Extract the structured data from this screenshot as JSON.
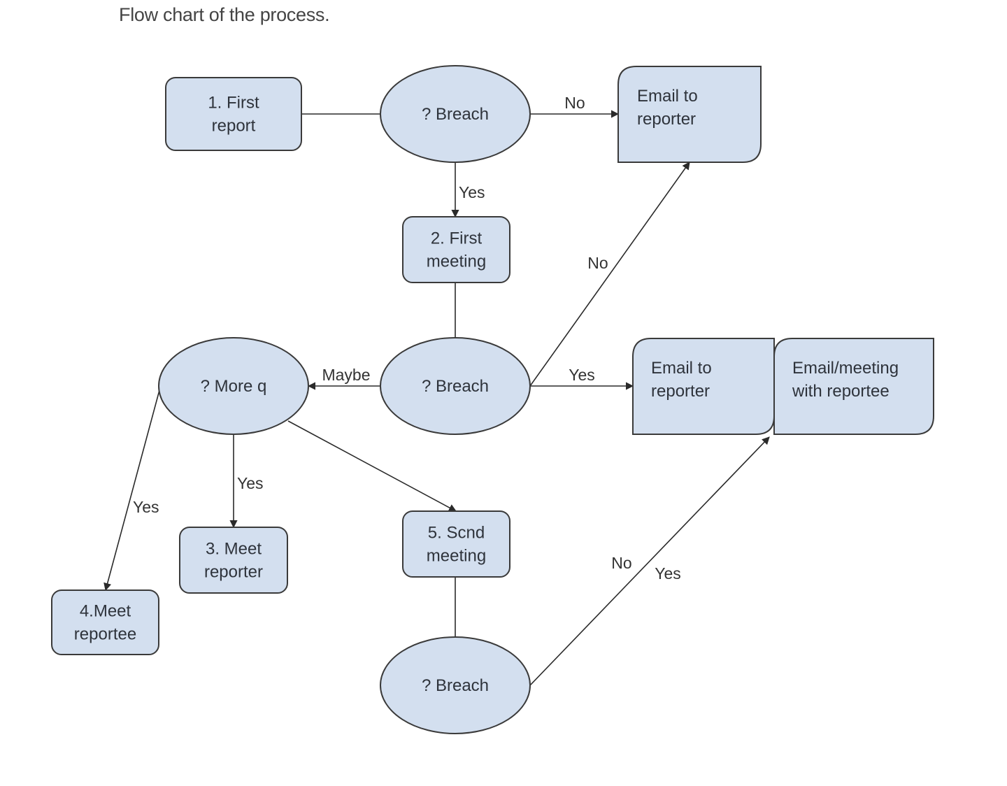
{
  "caption": "Flow chart of the process.",
  "colors": {
    "node_fill": "#d3dfef",
    "node_stroke": "#3a3a3a",
    "edge": "#2a2a2a",
    "text": "#2e333b"
  },
  "nodes": [
    {
      "id": "first-report",
      "shape": "rounded-rect",
      "lines": [
        "1. First",
        "report"
      ]
    },
    {
      "id": "breach-1",
      "shape": "ellipse",
      "lines": [
        "? Breach"
      ]
    },
    {
      "id": "email-reporter-1",
      "shape": "document",
      "lines": [
        "Email to",
        "reporter"
      ]
    },
    {
      "id": "first-meeting",
      "shape": "rounded-rect",
      "lines": [
        "2. First",
        "meeting"
      ]
    },
    {
      "id": "more-q",
      "shape": "ellipse",
      "lines": [
        "? More q"
      ]
    },
    {
      "id": "breach-2",
      "shape": "ellipse",
      "lines": [
        "? Breach"
      ]
    },
    {
      "id": "email-reporter-2",
      "shape": "document",
      "lines": [
        "Email to",
        "reporter"
      ]
    },
    {
      "id": "email-meeting-reportee",
      "shape": "document",
      "lines": [
        "Email/meeting",
        "with reportee"
      ]
    },
    {
      "id": "meet-reporter",
      "shape": "rounded-rect",
      "lines": [
        "3. Meet",
        "reporter"
      ]
    },
    {
      "id": "meet-reportee",
      "shape": "rounded-rect",
      "lines": [
        "4.Meet",
        "reportee"
      ]
    },
    {
      "id": "second-meeting",
      "shape": "rounded-rect",
      "lines": [
        "5. Scnd",
        "meeting"
      ]
    },
    {
      "id": "breach-3",
      "shape": "ellipse",
      "lines": [
        "? Breach"
      ]
    }
  ],
  "edges": [
    {
      "from": "first-report",
      "to": "breach-1",
      "label": "",
      "arrow": false
    },
    {
      "from": "breach-1",
      "to": "email-reporter-1",
      "label": "No",
      "arrow": true
    },
    {
      "from": "breach-1",
      "to": "first-meeting",
      "label": "Yes",
      "arrow": true
    },
    {
      "from": "first-meeting",
      "to": "breach-2",
      "label": "",
      "arrow": false
    },
    {
      "from": "breach-2",
      "to": "email-reporter-1",
      "label": "No",
      "arrow": true
    },
    {
      "from": "breach-2",
      "to": "email-reporter-2",
      "label": "Yes",
      "arrow": true
    },
    {
      "from": "breach-2",
      "to": "more-q",
      "label": "Maybe",
      "arrow": true
    },
    {
      "from": "more-q",
      "to": "meet-reporter",
      "label": "Yes",
      "arrow": true
    },
    {
      "from": "more-q",
      "to": "meet-reportee",
      "label": "Yes",
      "arrow": true
    },
    {
      "from": "more-q",
      "to": "second-meeting",
      "label": "",
      "arrow": true
    },
    {
      "from": "second-meeting",
      "to": "breach-3",
      "label": "",
      "arrow": false
    },
    {
      "from": "breach-3",
      "to": "email-reporter-2",
      "label": "No",
      "arrow": true
    },
    {
      "from": "breach-3",
      "to": "email-reporter-2",
      "label": "Yes",
      "arrow": true
    }
  ]
}
